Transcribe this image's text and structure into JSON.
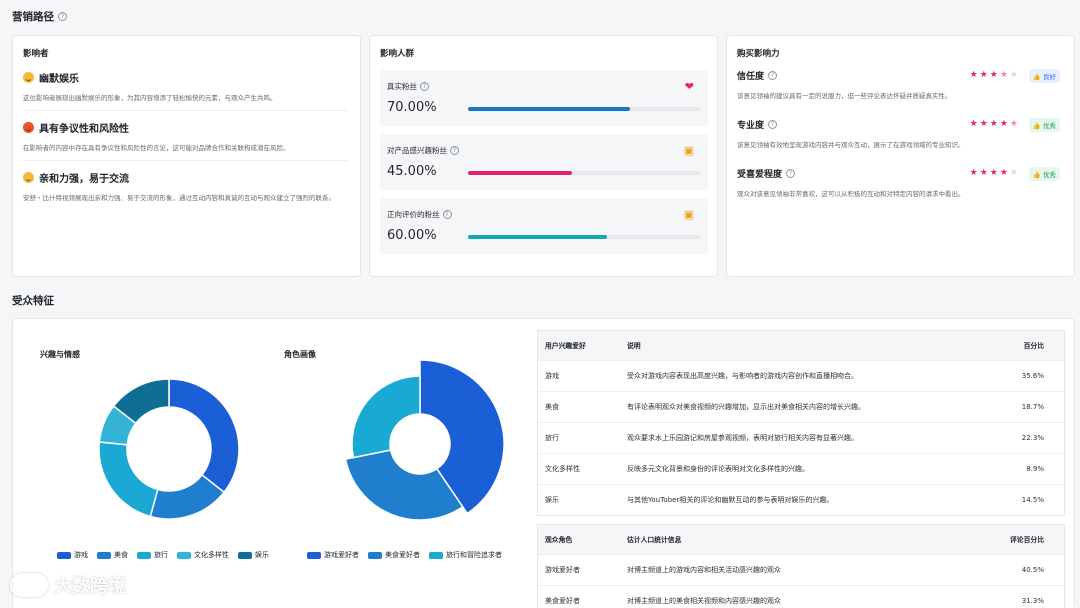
{
  "marketing": {
    "title": "营销路径",
    "influencer": {
      "title": "影响者",
      "items": [
        {
          "label": "幽默娱乐",
          "desc": "这位影响者展现出幽默娱乐的形象，为其内容增添了轻松愉快的元素，与观众产生共鸣。"
        },
        {
          "label": "具有争议性和风险性",
          "desc": "在影响者的内容中存在具有争议性和风险性的言论，这可能对品牌合作和关联构成潜在风险。"
        },
        {
          "label": "亲和力强，易于交流",
          "desc": "安舒・比什特视频展现出亲和力强、易于交流的形象，通过互动内容和真诚的互动与观众建立了强烈的联系。"
        }
      ]
    },
    "audience": {
      "title": "影响人群",
      "items": [
        {
          "label": "真实粉丝",
          "value_text": "70.00%",
          "value": 0.7,
          "color": "#1677c8"
        },
        {
          "label": "对产品感兴趣粉丝",
          "value_text": "45.00%",
          "value": 0.45,
          "color": "#e3246b"
        },
        {
          "label": "正向评价的粉丝",
          "value_text": "60.00%",
          "value": 0.6,
          "color": "#16a6b6"
        }
      ]
    },
    "purchase": {
      "title": "购买影响力",
      "items": [
        {
          "label": "信任度",
          "desc": "该意见领袖的建议具有一定的说服力，但一些评论表达怀疑并质疑真实性。",
          "rating": 3.5,
          "badge": "良好",
          "badge_type": "good"
        },
        {
          "label": "专业度",
          "desc": "该意见领袖有效地呈现游戏内容并与观众互动，展示了在游戏领域的专业知识。",
          "rating": 4.5,
          "badge": "优秀",
          "badge_type": "excellent"
        },
        {
          "label": "受喜爱程度",
          "desc": "观众对该意见领袖非常喜欢，这可以从积极的互动和对特定内容的请求中看出。",
          "rating": 4,
          "badge": "优秀",
          "badge_type": "excellent"
        }
      ]
    }
  },
  "audience_traits": {
    "title": "受众特征"
  },
  "chart_data": [
    {
      "type": "pie",
      "title": "兴趣与情感",
      "categories": [
        "游戏",
        "美食",
        "旅行",
        "文化多样性",
        "娱乐"
      ],
      "values": [
        35.6,
        18.7,
        22.3,
        8.9,
        14.5
      ],
      "colors": [
        "#1a5fd6",
        "#1f7fce",
        "#19a9d4",
        "#33b4d6",
        "#0e6e93"
      ]
    },
    {
      "type": "pie",
      "title": "角色画像",
      "categories": [
        "游戏爱好者",
        "美食爱好者",
        "旅行和冒险追求者"
      ],
      "values": [
        40.5,
        31.3,
        28.2
      ],
      "colors": [
        "#1a5fd6",
        "#1f7fce",
        "#19a9d4"
      ]
    }
  ],
  "interest_table": {
    "headers": [
      "用户兴趣爱好",
      "说明",
      "百分比"
    ],
    "rows": [
      {
        "name": "游戏",
        "desc": "受众对游戏内容表现出高度兴趣，与影响者的游戏内容创作和直播相吻合。",
        "pct": "35.6%"
      },
      {
        "name": "美食",
        "desc": "有评论表明观众对美食视频的兴趣增加，显示出对美食相关内容的增长兴趣。",
        "pct": "18.7%"
      },
      {
        "name": "旅行",
        "desc": "观众要求水上乐园游记和房屋参观视频，表明对旅行相关内容有显著兴趣。",
        "pct": "22.3%"
      },
      {
        "name": "文化多样性",
        "desc": "反映多元文化背景和身份的评论表明对文化多样性的兴趣。",
        "pct": "8.9%"
      },
      {
        "name": "娱乐",
        "desc": "与其他YouTuber相关的评论和幽默互动的参与表明对娱乐的兴趣。",
        "pct": "14.5%"
      }
    ]
  },
  "role_table": {
    "headers": [
      "观众角色",
      "估计人口统计信息",
      "评论百分比"
    ],
    "rows": [
      {
        "name": "游戏爱好者",
        "desc": "对博主频道上的游戏内容和相关活动感兴趣的观众",
        "pct": "40.5%"
      },
      {
        "name": "美食爱好者",
        "desc": "对博主频道上的美食相关视频和内容感兴趣的观众",
        "pct": "31.3%"
      }
    ]
  },
  "watermark": {
    "text": "大数跨境"
  }
}
